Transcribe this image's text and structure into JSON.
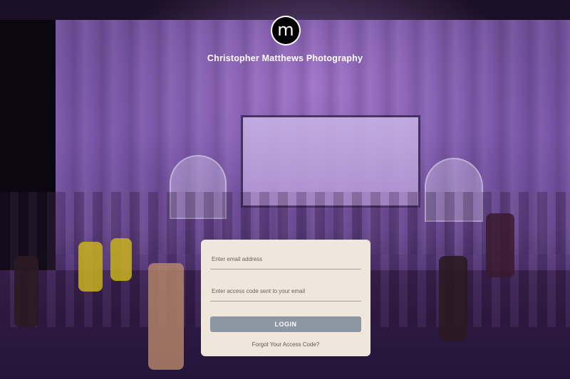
{
  "brand": {
    "logo_letter": "m",
    "title": "Christopher Matthews Photography"
  },
  "login": {
    "email_placeholder": "Enter email address",
    "code_placeholder": "Enter access code sent to your email",
    "button_label": "LOGIN",
    "forgot_link": "Forgot Your Access Code?"
  },
  "colors": {
    "card_background": "#efe7dc",
    "button": "#8d96a3"
  }
}
